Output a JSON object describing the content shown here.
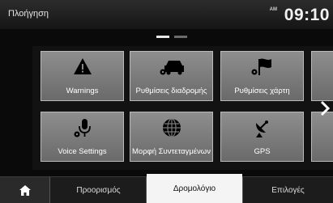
{
  "header": {
    "title": "Πλοήγηση",
    "clock": "09:10",
    "clock_prefix": "AM"
  },
  "pager": {
    "active_page": 1,
    "page_count": 2
  },
  "menu": {
    "tiles": [
      {
        "label": "Warnings",
        "icon": "warning-icon"
      },
      {
        "label": "Ρυθμίσεις διαδρομής",
        "icon": "car-settings-icon"
      },
      {
        "label": "Ρυθμίσεις χάρτη",
        "icon": "flag-settings-icon"
      },
      {
        "label": "Voice Settings",
        "icon": "microphone-settings-icon"
      },
      {
        "label": "Μορφή Συντεταγμένων",
        "icon": "globe-icon"
      },
      {
        "label": "GPS",
        "icon": "satellite-dish-icon"
      }
    ],
    "next_icon": "chevron-right-icon"
  },
  "tabs": [
    {
      "label": "",
      "icon": "home-icon"
    },
    {
      "label": "Προορισμός"
    },
    {
      "label": "Δρομολόγιο",
      "active": true
    },
    {
      "label": "Επιλογές"
    }
  ],
  "colors": {
    "tile_top": "#8e8e8e",
    "tile_bottom": "#6a6a6a",
    "active_tab": "#f4f4f4",
    "background": "#0a0a0a"
  }
}
